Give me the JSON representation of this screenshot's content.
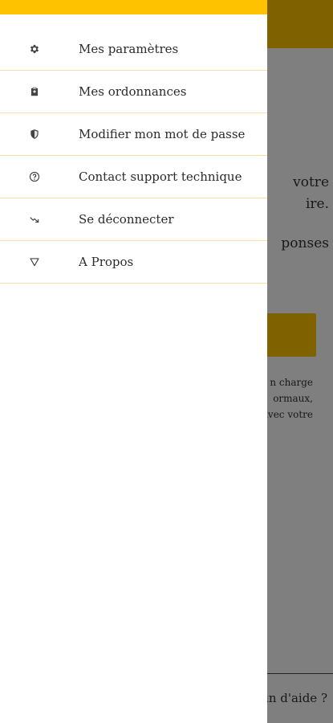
{
  "background_page": {
    "line_1": "votre",
    "line_2": "ire.",
    "line_3": "ponses",
    "small_1": "n charge",
    "small_2": "ormaux,",
    "small_3": "avec votre",
    "help_text": "oin d'aide ?"
  },
  "menu": {
    "items": [
      {
        "label": "Mes paramètres",
        "icon": "gear-icon"
      },
      {
        "label": "Mes ordonnances",
        "icon": "clipboard-icon"
      },
      {
        "label": "Modifier mon mot de passe",
        "icon": "shield-icon"
      },
      {
        "label": "Contact support technique",
        "icon": "help-circle-icon"
      },
      {
        "label": "Se déconnecter",
        "icon": "logout-icon"
      },
      {
        "label": "A Propos",
        "icon": "triangle-icon"
      }
    ]
  },
  "colors": {
    "accent": "#ffc200",
    "divider": "#f6e0a6",
    "overlay": "rgba(0,0,0,0.5)"
  }
}
